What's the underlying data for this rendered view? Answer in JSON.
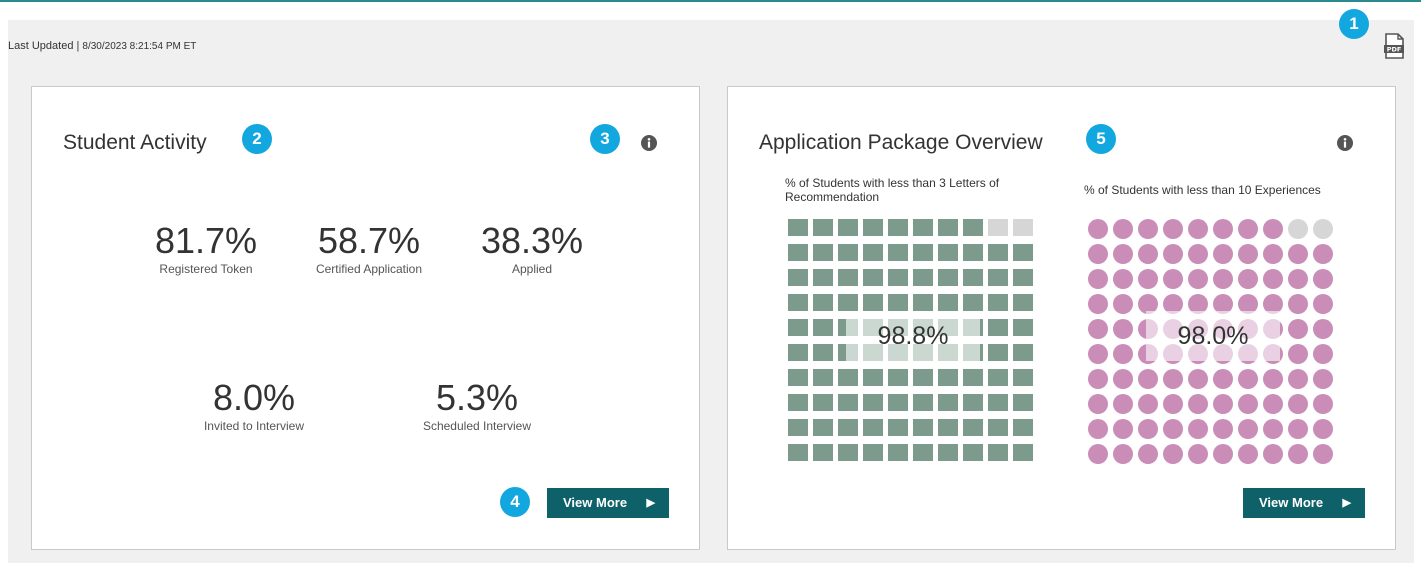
{
  "header": {
    "last_updated_label": "Last Updated | ",
    "last_updated_value": "8/30/2023 8:21:54 PM ET",
    "pdf_icon": "pdf-export-icon"
  },
  "callouts": [
    "1",
    "2",
    "3",
    "4",
    "5"
  ],
  "colors": {
    "callout": "#13a7e0",
    "button": "#0e6169",
    "square_filled": "#7d9b8c",
    "circle_filled": "#c98db8",
    "empty": "#d6d6d6"
  },
  "student_activity": {
    "title": "Student Activity",
    "info_icon": "info-icon",
    "stats": [
      {
        "value": "81.7%",
        "label": "Registered Token"
      },
      {
        "value": "58.7%",
        "label": "Certified Application"
      },
      {
        "value": "38.3%",
        "label": "Applied"
      },
      {
        "value": "8.0%",
        "label": "Invited to Interview"
      },
      {
        "value": "5.3%",
        "label": "Scheduled Interview"
      }
    ],
    "view_more": "View More",
    "arrow": "▶"
  },
  "application_package": {
    "title": "Application Package Overview",
    "info_icon": "info-icon",
    "view_more": "View More",
    "arrow": "▶",
    "waffles": [
      {
        "title_line1": "% of Students with less than 3 Letters of",
        "title_line2": "Recommendation",
        "value_text": "98.8%",
        "percent": 98.8,
        "shape": "square"
      },
      {
        "title_line1": "% of Students with less than 10 Experiences",
        "title_line2": "",
        "value_text": "98.0%",
        "percent": 98.0,
        "shape": "circle"
      }
    ]
  }
}
